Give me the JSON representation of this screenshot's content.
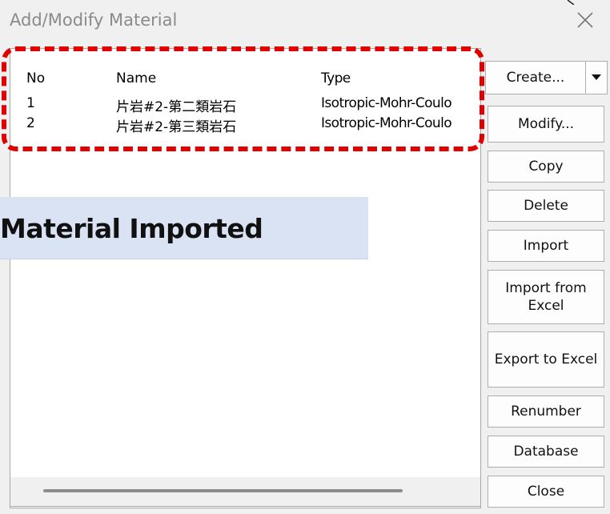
{
  "window": {
    "title": "Add/Modify Material",
    "close_icon": "close-icon"
  },
  "list": {
    "columns": [
      "No",
      "Name",
      "Type"
    ],
    "rows": [
      {
        "no": "1",
        "name": "片岩#2-第二類岩石",
        "type": "Isotropic-Mohr-Coulo"
      },
      {
        "no": "2",
        "name": "片岩#2-第三類岩石",
        "type": "Isotropic-Mohr-Coulo"
      }
    ]
  },
  "annotation": {
    "banner_text": "Material Imported",
    "highlight_color": "#e00000",
    "banner_color": "#dae3f3"
  },
  "buttons": {
    "create": "Create...",
    "create_dropdown_icon": "triangle-down-icon",
    "modify": "Modify...",
    "copy": "Copy",
    "delete": "Delete",
    "import": "Import",
    "import_from_excel": "Import from\nExcel",
    "export_to_excel": "Export to Excel",
    "renumber": "Renumber",
    "database": "Database",
    "close": "Close"
  }
}
